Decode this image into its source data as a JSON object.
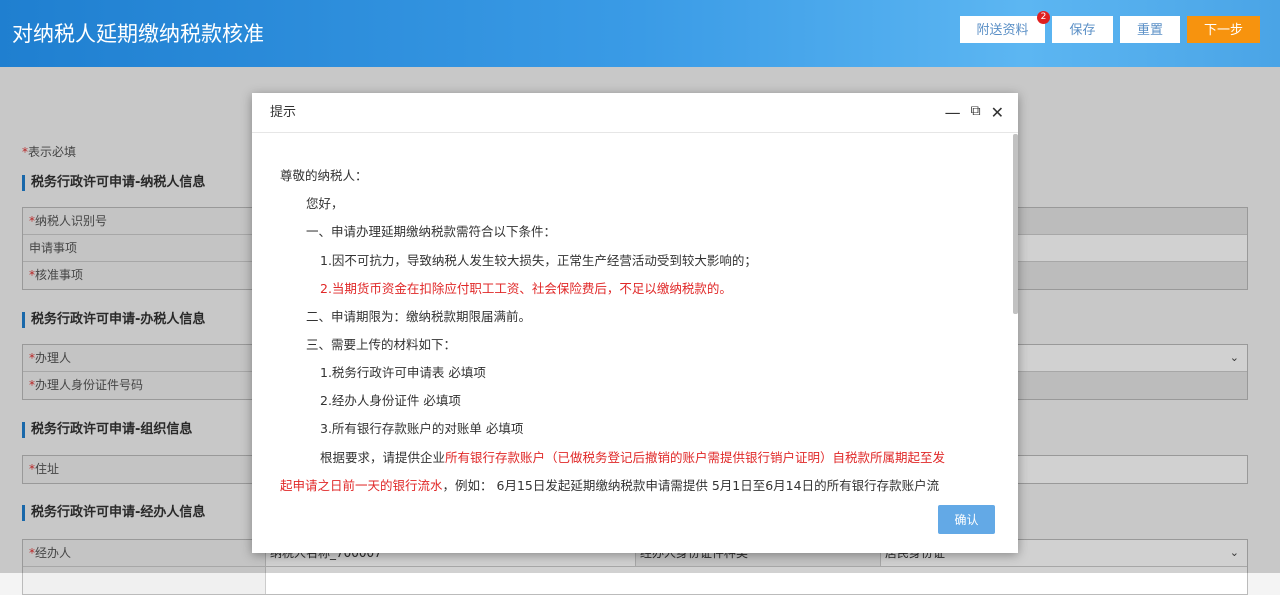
{
  "header": {
    "title": "对纳税人延期缴纳税款核准",
    "buttons": {
      "attach": "附送资料",
      "attach_badge": "2",
      "save": "保存",
      "reset": "重置",
      "next": "下一步"
    }
  },
  "form": {
    "required_note": "表示必填",
    "star": "*",
    "sections": [
      {
        "title": "税务行政许可申请-纳税人信息",
        "rows": [
          "纳税人识别号",
          "申请事项",
          "核准事项"
        ]
      },
      {
        "title": "税务行政许可申请-办税人信息",
        "rows": [
          "办理人",
          "办理人身份证件号码"
        ]
      },
      {
        "title": "税务行政许可申请-组织信息",
        "rows": [
          "住址"
        ]
      },
      {
        "title": "税务行政许可申请-经办人信息",
        "rows": [
          "经办人"
        ],
        "row_values": [
          "纳税人名称_700007",
          "经办人身份证件种类",
          "居民身份证"
        ]
      }
    ]
  },
  "dialog": {
    "title": "提示",
    "confirm": "确认",
    "lines": {
      "greeting": "尊敬的纳税人：",
      "hello": "您好，",
      "s1": "一、申请办理延期缴纳税款需符合以下条件：",
      "s1_1": "1.因不可抗力，导致纳税人发生较大损失，正常生产经营活动受到较大影响的；",
      "s1_2": "2.当期货币资金在扣除应付职工工资、社会保险费后，不足以缴纳税款的。",
      "s2": "二、申请期限为：缴纳税款期限届满前。",
      "s3": "三、需要上传的材料如下：",
      "s3_1": "1.税务行政许可申请表 必填项",
      "s3_2": "2.经办人身份证件 必填项",
      "s3_3": "3.所有银行存款账户的对账单 必填项",
      "p1a": "根据要求，请提供企业",
      "p1b": "所有银行存款账户（已做税务登记后撤销的账户需提供银行销户证明）自税款所属期起至发",
      "p2a": "起申请之日前一天的银行流水",
      "p2b": "，例如： 6月15日发起延期缴纳税款申请需提供 5月1日至6月14日的所有银行存款账户流"
    }
  }
}
